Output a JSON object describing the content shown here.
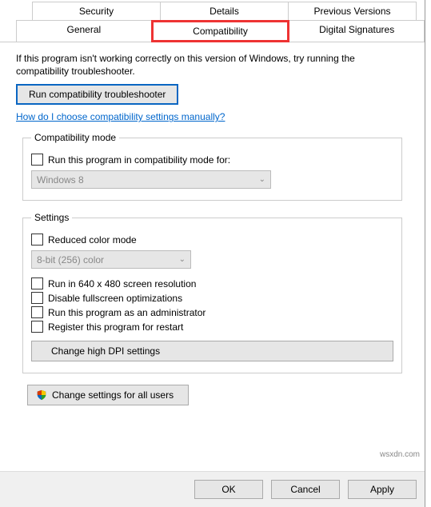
{
  "tabs": {
    "row1": [
      "Security",
      "Details",
      "Previous Versions"
    ],
    "row2": [
      "General",
      "Compatibility",
      "Digital Signatures"
    ],
    "active": "Compatibility"
  },
  "intro": "If this program isn't working correctly on this version of Windows, try running the compatibility troubleshooter.",
  "buttons": {
    "troubleshoot": "Run compatibility troubleshooter",
    "dpi": "Change high DPI settings",
    "all_users": "Change settings for all users",
    "ok": "OK",
    "cancel": "Cancel",
    "apply": "Apply"
  },
  "link": "How do I choose compatibility settings manually?",
  "groups": {
    "compat_mode": {
      "legend": "Compatibility mode",
      "checkbox": "Run this program in compatibility mode for:",
      "select": "Windows 8"
    },
    "settings": {
      "legend": "Settings",
      "reduced_color": "Reduced color mode",
      "color_select": "8-bit (256) color",
      "run640": "Run in 640 x 480 screen resolution",
      "disable_fullscreen": "Disable fullscreen optimizations",
      "run_admin": "Run this program as an administrator",
      "register_restart": "Register this program for restart"
    }
  },
  "watermark": "wsxdn.com"
}
